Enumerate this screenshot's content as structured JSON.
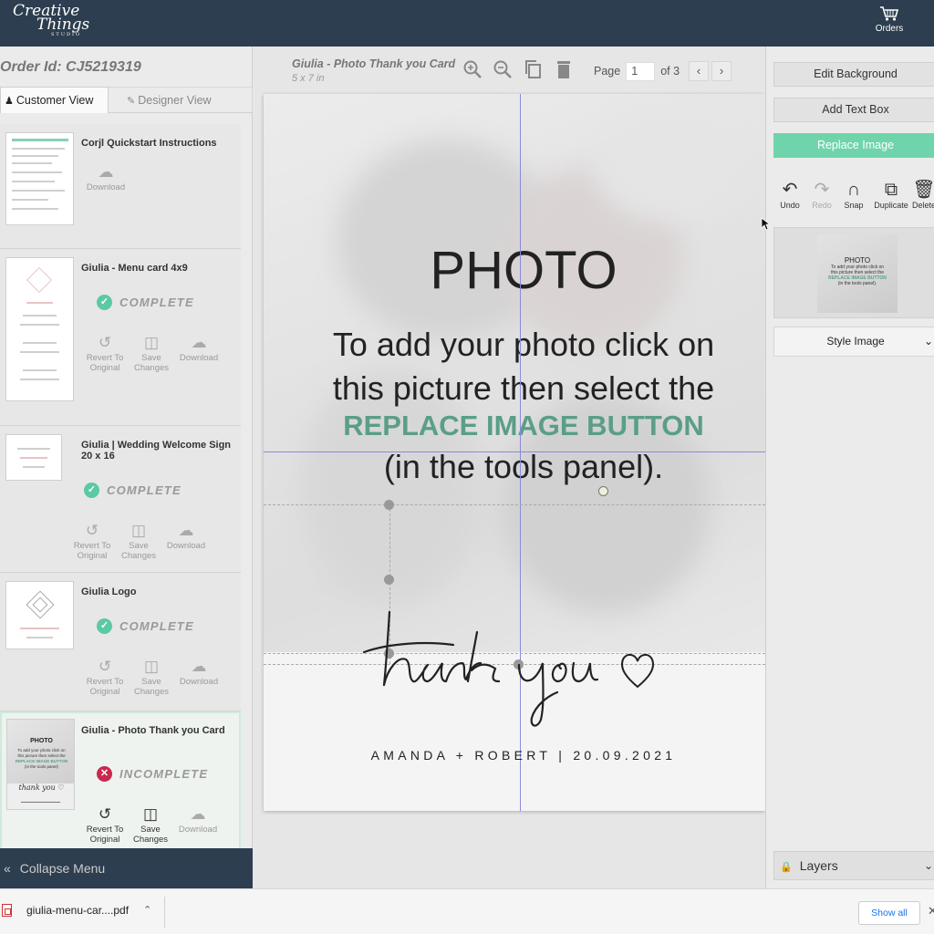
{
  "app": {
    "logo_line1": "Creative",
    "logo_line2": "Things",
    "logo_line3": "STUDIO",
    "orders_label": "Orders"
  },
  "left_panel": {
    "order_id": "Order Id: CJ5219319",
    "tabs": [
      {
        "label": "Customer View",
        "active": true,
        "icon": "user-icon"
      },
      {
        "label": "Designer View",
        "active": false,
        "icon": "pencil-icon"
      }
    ],
    "cards": [
      {
        "title": "Corjl Quickstart Instructions",
        "status": "",
        "actions": [
          "Download"
        ]
      },
      {
        "title": "Giulia - Menu card 4x9",
        "status": "COMPLETE",
        "actions": [
          "Revert To Original",
          "Save Changes",
          "Download"
        ]
      },
      {
        "title": "Giulia | Wedding Welcome Sign 20 x 16",
        "status": "COMPLETE",
        "actions": [
          "Revert To Original",
          "Save Changes",
          "Download"
        ]
      },
      {
        "title": "Giulia Logo",
        "status": "COMPLETE",
        "actions": [
          "Revert To Original",
          "Save Changes",
          "Download"
        ]
      },
      {
        "title": "Giulia - Photo Thank you Card",
        "status": "INCOMPLETE",
        "actions": [
          "Revert To Original",
          "Save Changes",
          "Download"
        ]
      }
    ],
    "collapse_label": "Collapse Menu"
  },
  "editor": {
    "doc_title": "Giulia - Photo Thank you Card",
    "doc_size": "5 x 7 in",
    "page_label": "Page",
    "page_value": "1",
    "page_of": "of 3",
    "tools": [
      "zoom-in-icon",
      "zoom-out-icon",
      "copy-icon",
      "trash-icon"
    ]
  },
  "canvas": {
    "title": "PHOTO",
    "line1": "To add your photo click on",
    "line2": "this picture then select the",
    "green_line": "REPLACE IMAGE BUTTON",
    "line4": "(in the tools panel).",
    "script_text": "thank you",
    "names": "AMANDA + ROBERT | 20.09.2021"
  },
  "right_panel": {
    "edit_background": "Edit Background",
    "add_text_box": "Add Text Box",
    "replace_image": "Replace Image",
    "tools": [
      {
        "label": "Undo",
        "icon": "undo-icon",
        "enabled": true
      },
      {
        "label": "Redo",
        "icon": "redo-icon",
        "enabled": false
      },
      {
        "label": "Snap",
        "icon": "magnet-icon",
        "enabled": true
      },
      {
        "label": "Duplicate",
        "icon": "duplicate-icon",
        "enabled": true
      },
      {
        "label": "Delete",
        "icon": "trash-icon",
        "enabled": true
      }
    ],
    "preview": {
      "title": "PHOTO",
      "l1": "To add your photo click on",
      "l2": "this picture then select the",
      "green": "REPLACE IMAGE BUTTON",
      "l4": "(in the tools panel)."
    },
    "style_image": "Style Image",
    "layers": "Layers"
  },
  "download_bar": {
    "file_name": "giulia-menu-car....pdf",
    "show_all": "Show all"
  },
  "colors": {
    "header": "#2c3e4f",
    "accent_green": "#6fd4ab",
    "complete_green": "#5bc9a2",
    "incomplete_red": "#c9284f",
    "text_green": "#5a9e88"
  }
}
